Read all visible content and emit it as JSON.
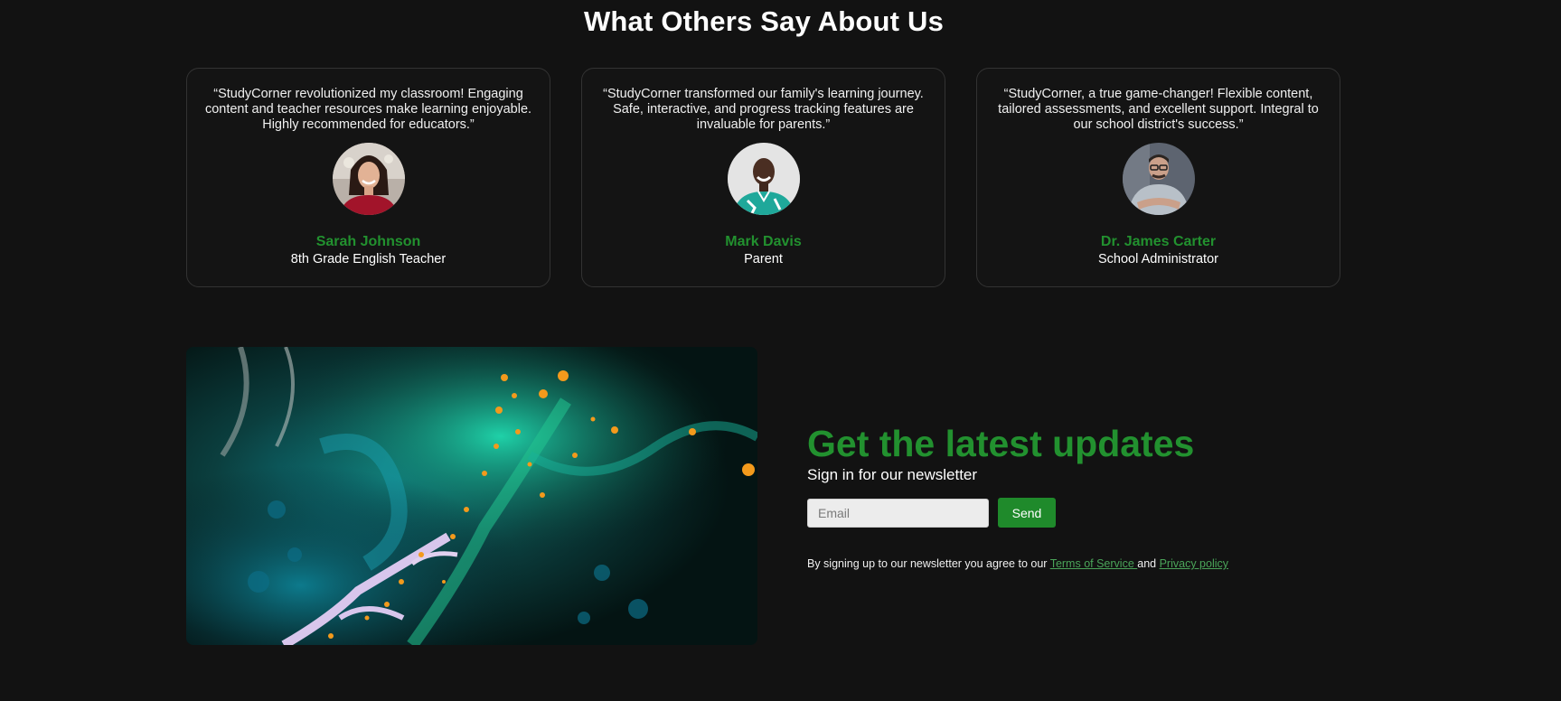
{
  "testimonials": {
    "title": "What Others Say About Us",
    "items": [
      {
        "quote": "“StudyCorner revolutionized my classroom! Engaging content and teacher resources make learning enjoyable. Highly recommended for educators.”",
        "name": "Sarah Johnson",
        "role": "8th Grade English Teacher"
      },
      {
        "quote": "“StudyCorner transformed our family's learning journey. Safe, interactive, and progress tracking features are invaluable for parents.”",
        "name": "Mark Davis",
        "role": "Parent"
      },
      {
        "quote": "“StudyCorner, a true game-changer! Flexible content, tailored assessments, and excellent support. Integral to our school district's success.”",
        "name": "Dr. James Carter",
        "role": "School Administrator"
      }
    ]
  },
  "newsletter": {
    "title": "Get the latest updates",
    "subtitle": "Sign in for our newsletter",
    "email_placeholder": "Email",
    "send_label": "Send",
    "legal_prefix": "By signing up to our newsletter you agree to our ",
    "terms_link": "Terms of Service ",
    "legal_and": "and ",
    "privacy_link": "Privacy policy"
  },
  "colors": {
    "background": "#121212",
    "accent_green": "#22912f",
    "button_green": "#1f8a2b",
    "link_green": "#4aa459"
  }
}
